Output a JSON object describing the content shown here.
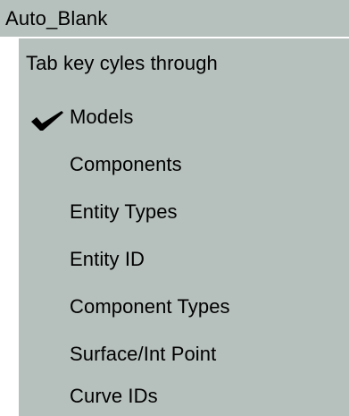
{
  "window": {
    "title": "Auto_Blank"
  },
  "menu": {
    "header": "Tab key cyles through",
    "items": [
      {
        "label": "Models",
        "checked": true
      },
      {
        "label": "Components",
        "checked": false
      },
      {
        "label": "Entity Types",
        "checked": false
      },
      {
        "label": "Entity ID",
        "checked": false
      },
      {
        "label": "Component Types",
        "checked": false
      },
      {
        "label": "Surface/Int Point",
        "checked": false
      },
      {
        "label": "Curve IDs",
        "checked": false
      }
    ]
  },
  "colors": {
    "panel_background": "#b6c0bc",
    "highlight_border": "#ffffff",
    "text": "#000000"
  },
  "icons": {
    "checked_indicator": "checkmark-icon"
  }
}
